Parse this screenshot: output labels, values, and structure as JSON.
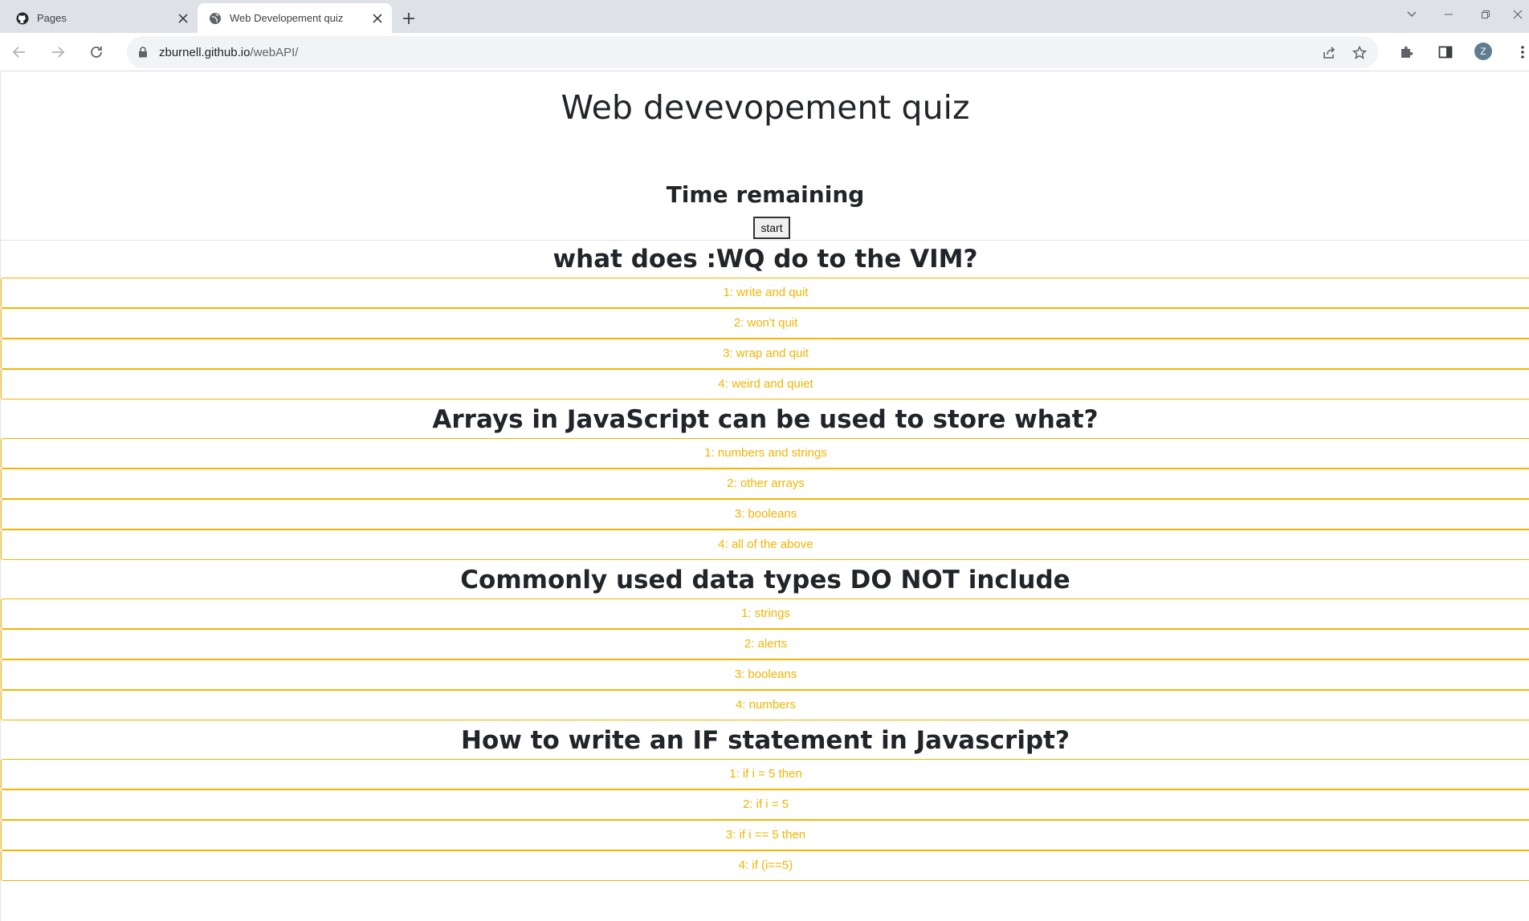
{
  "browser": {
    "tabs": [
      {
        "title": "Pages",
        "favicon": "github-icon",
        "active": false
      },
      {
        "title": "Web Developement quiz",
        "favicon": "globe-icon",
        "active": true
      }
    ],
    "url_host": "zburnell.github.io",
    "url_path": "/webAPI/",
    "profile_initial": "Z",
    "accent_color": "#f4b400"
  },
  "page": {
    "title": "Web devevopement quiz",
    "timer_label": "Time remaining",
    "start_label": "start"
  },
  "questions": [
    {
      "title": "what does :WQ do to the VIM?",
      "answers": [
        "1: write and quit",
        "2: won't quit",
        "3: wrap and quit",
        "4: weird and quiet"
      ]
    },
    {
      "title": "Arrays in JavaScript can be used to store what?",
      "answers": [
        "1: numbers and strings",
        "2: other arrays",
        "3: booleans",
        "4: all of the above"
      ]
    },
    {
      "title": "Commonly used data types DO NOT include",
      "answers": [
        "1: strings",
        "2: alerts",
        "3: booleans",
        "4: numbers"
      ]
    },
    {
      "title": "How to write an IF statement in Javascript?",
      "answers": [
        "1: if i = 5 then",
        "2: if i = 5",
        "3: if i == 5 then",
        "4: if (i==5)"
      ]
    }
  ]
}
